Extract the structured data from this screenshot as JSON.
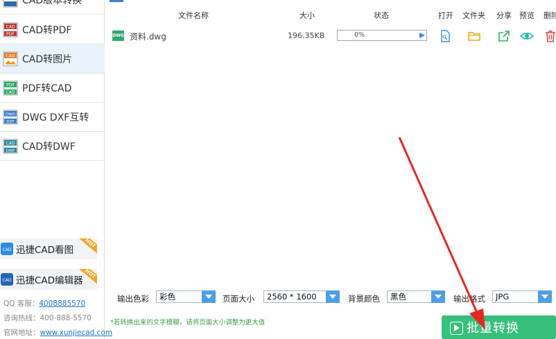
{
  "sidebar": {
    "items": [
      {
        "label": "CAD版本转换",
        "icon": "cad-version-icon"
      },
      {
        "label": "CAD转PDF",
        "icon": "cad-to-pdf-icon"
      },
      {
        "label": "CAD转图片",
        "icon": "cad-to-image-icon",
        "active": true
      },
      {
        "label": "PDF转CAD",
        "icon": "pdf-to-cad-icon"
      },
      {
        "label": "DWG DXF互转",
        "icon": "dwg-dxf-icon"
      },
      {
        "label": "CAD转DWF",
        "icon": "cad-to-dwf-icon"
      }
    ],
    "promos": [
      {
        "label": "迅捷CAD看图",
        "badge": "HOT"
      },
      {
        "label": "迅捷CAD编辑器",
        "badge": "HOT"
      }
    ],
    "contact": {
      "qq_label": "QQ 客服：",
      "qq_value": "4008885570",
      "phone_label": "咨询热线：400-888-5570",
      "site_label": "官网地址：",
      "site_value": "www.xunjiecad.com"
    }
  },
  "table": {
    "headers": {
      "filename": "文件名称",
      "size": "大小",
      "status": "状态",
      "open": "打开",
      "folder": "文件夹",
      "share": "分享",
      "preview": "预览",
      "delete": "删除"
    },
    "rows": [
      {
        "icon_text": "DWG",
        "filename": "资料.dwg",
        "size": "196.35KB",
        "progress_text": "0%",
        "progress": 0
      }
    ]
  },
  "options": {
    "color_label": "输出色彩",
    "color_value": "彩色",
    "pagesize_label": "页面大小",
    "pagesize_value": "2560 * 1600",
    "bg_label": "背景颜色",
    "bg_value": "黑色",
    "format_label": "输出格式",
    "format_value": "JPG"
  },
  "tip": "*若转换出来的文字模糊，请将页面大小调整为更大值",
  "batch_button": "批量转换",
  "colors": {
    "accent": "#36c07c",
    "select": "#4f9ee8",
    "arrow": "#e8261f"
  }
}
